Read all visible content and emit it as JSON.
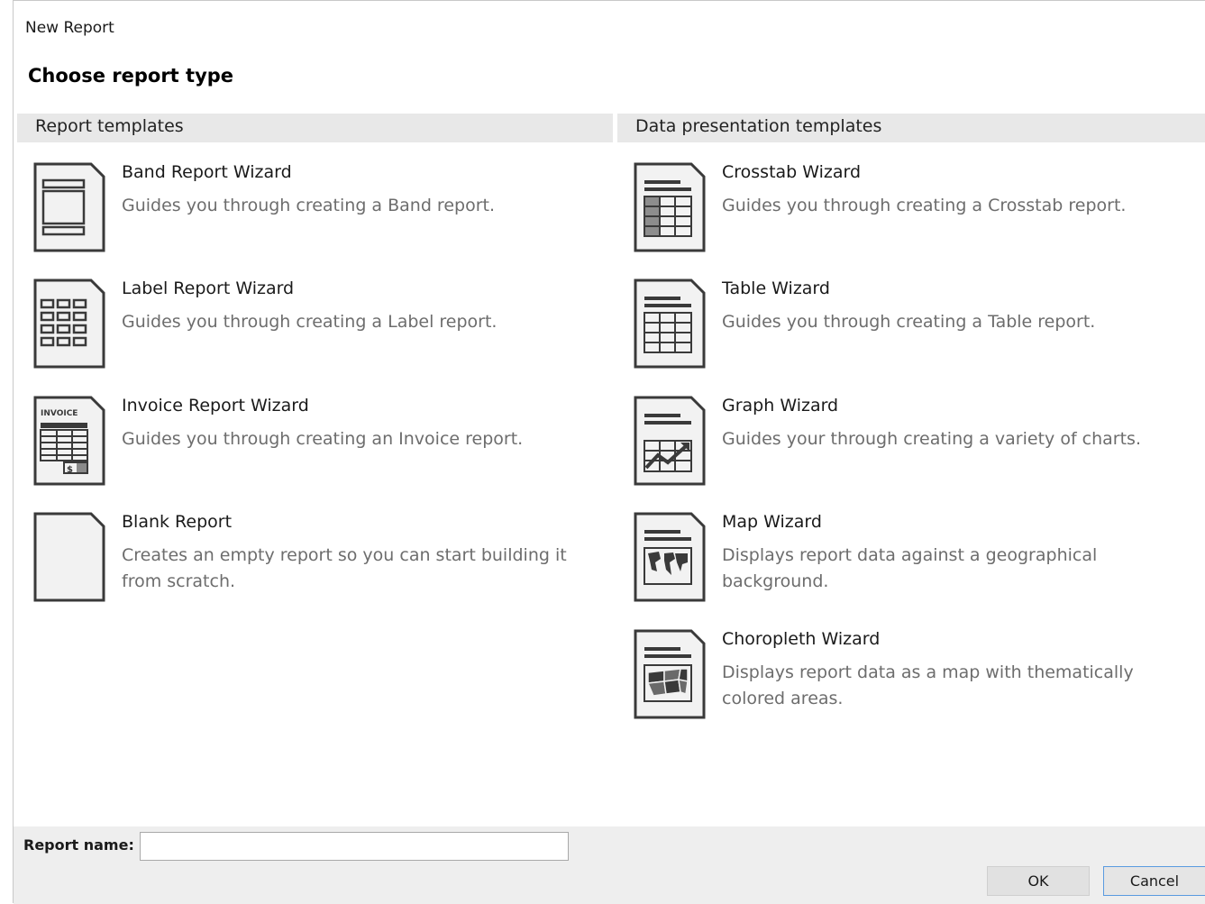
{
  "window": {
    "title": "New Report"
  },
  "heading": "Choose report type",
  "sections": {
    "report_templates": "Report templates",
    "data_templates": "Data presentation templates"
  },
  "report_templates": [
    {
      "icon": "band-report-icon",
      "name": "Band Report Wizard",
      "desc": "Guides you through creating a Band report."
    },
    {
      "icon": "label-report-icon",
      "name": "Label Report Wizard",
      "desc": "Guides you through creating a Label report."
    },
    {
      "icon": "invoice-report-icon",
      "name": "Invoice Report Wizard",
      "desc": "Guides you through creating an Invoice report.",
      "icon_text": "INVOICE"
    },
    {
      "icon": "blank-report-icon",
      "name": "Blank Report",
      "desc": "Creates an empty report so you can start building it from scratch."
    }
  ],
  "data_templates": [
    {
      "icon": "crosstab-icon",
      "name": "Crosstab Wizard",
      "desc": "Guides you through creating a Crosstab report."
    },
    {
      "icon": "table-icon",
      "name": "Table Wizard",
      "desc": "Guides you through creating a Table report."
    },
    {
      "icon": "graph-icon",
      "name": "Graph Wizard",
      "desc": "Guides your through creating a variety of charts."
    },
    {
      "icon": "map-icon",
      "name": "Map Wizard",
      "desc": "Displays report data against a geographical background."
    },
    {
      "icon": "choropleth-icon",
      "name": "Choropleth Wizard",
      "desc": "Displays report data as a map with thematically colored areas."
    }
  ],
  "footer": {
    "report_name_label": "Report name:",
    "report_name_value": "",
    "ok_label": "OK",
    "cancel_label": "Cancel"
  }
}
